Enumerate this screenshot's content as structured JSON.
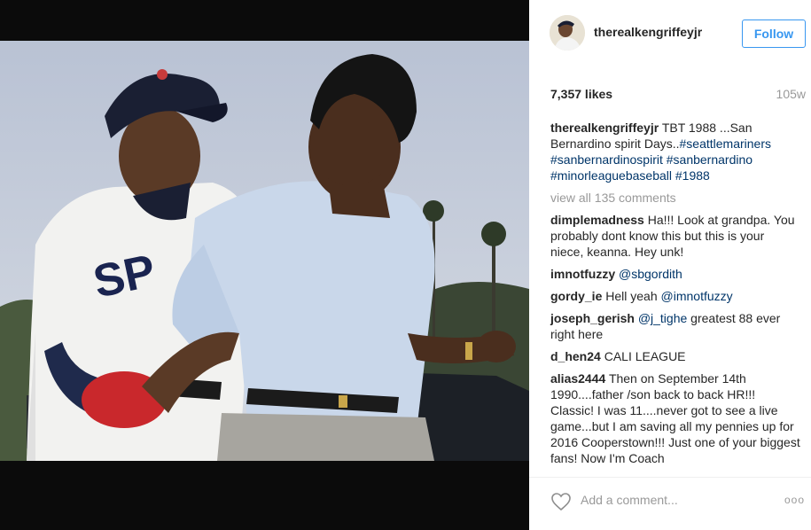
{
  "post": {
    "username": "therealkengriffeyjr",
    "follow_label": "Follow",
    "likes": "7,357 likes",
    "age": "105w",
    "caption": {
      "user": "therealkengriffeyjr",
      "text": "TBT 1988 ...San Bernardino spirit Days..",
      "hashtags": "#seattlemariners #sanbernardinospirit #sanbernardino #minorleaguebaseball #1988"
    },
    "view_all": "view all 135 comments",
    "comments": [
      {
        "user": "dimplemadness",
        "mention": "",
        "text": "Ha!!! Look at grandpa. You probably dont know this but this is your niece, keanna. Hey unk!"
      },
      {
        "user": "imnotfuzzy",
        "mention": "@sbgordith",
        "text": ""
      },
      {
        "user": "gordy_ie",
        "mention": "",
        "text": "Hell yeah",
        "mention_after": "@imnotfuzzy"
      },
      {
        "user": "joseph_gerish",
        "mention": "@j_tighe",
        "text": "greatest 88 ever right here"
      },
      {
        "user": "d_hen24",
        "mention": "",
        "text": "CALI LEAGUE"
      },
      {
        "user": "alias2444",
        "mention": "",
        "text": "Then on September 14th 1990....father /son back to back HR!!! Classic! I was 11....never got to see a live game...but I am saving all my pennies up for 2016 Cooperstown!!! Just one of your biggest fans! Now I'm Coach"
      }
    ],
    "add_comment_placeholder": "Add a comment...",
    "more_label": "ooo",
    "jersey_text": "SP",
    "colors": {
      "link": "#003569",
      "follow": "#3897f0",
      "muted": "#999999"
    }
  }
}
